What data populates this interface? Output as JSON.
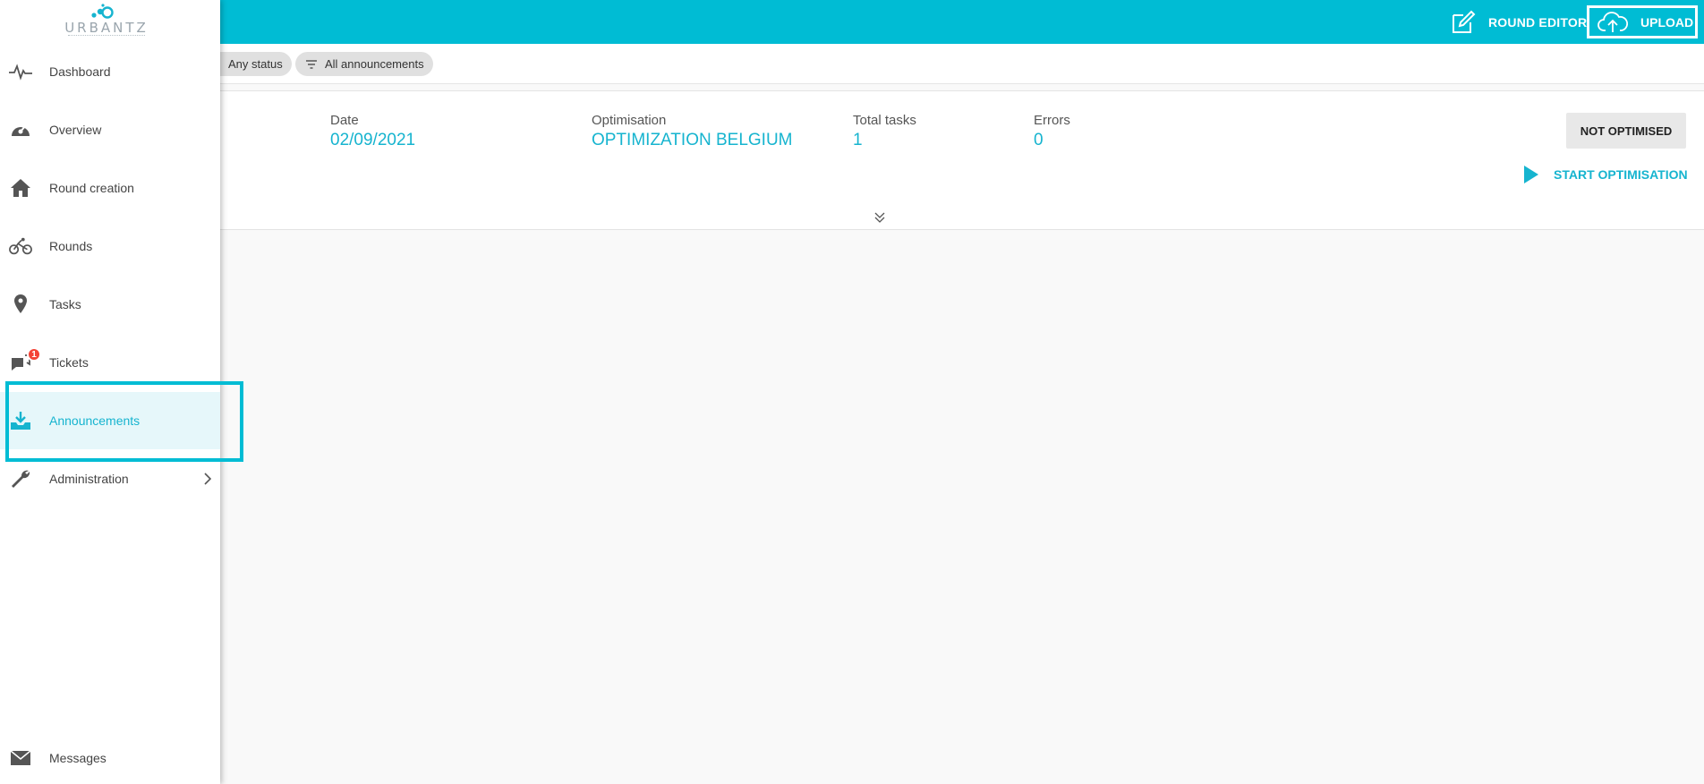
{
  "topbar": {
    "round_editor_label": "ROUND EDITOR",
    "upload_label": "UPLOAD"
  },
  "filters": {
    "status_chip": "Any status",
    "announcements_chip": "All announcements"
  },
  "summary": {
    "date_label": "Date",
    "date_value": "02/09/2021",
    "optimisation_label": "Optimisation",
    "optimisation_value": "OPTIMIZATION BELGIUM",
    "total_tasks_label": "Total tasks",
    "total_tasks_value": "1",
    "errors_label": "Errors",
    "errors_value": "0",
    "status": "NOT OPTIMISED",
    "start_label": "START OPTIMISATION"
  },
  "sidebar": {
    "logo_text": "URBANTZ",
    "items": [
      {
        "label": "Dashboard",
        "icon": "pulse-icon"
      },
      {
        "label": "Overview",
        "icon": "gauge-icon"
      },
      {
        "label": "Round creation",
        "icon": "home-icon"
      },
      {
        "label": "Rounds",
        "icon": "bike-icon"
      },
      {
        "label": "Tasks",
        "icon": "pin-icon"
      },
      {
        "label": "Tickets",
        "icon": "chat-icon",
        "badge": "1"
      },
      {
        "label": "Announcements",
        "icon": "download-tray-icon",
        "active": true
      },
      {
        "label": "Administration",
        "icon": "wrench-icon"
      }
    ],
    "messages_label": "Messages"
  },
  "colors": {
    "accent": "#00bcd4",
    "accent_text": "#16b4cf",
    "badge": "#f44336"
  }
}
